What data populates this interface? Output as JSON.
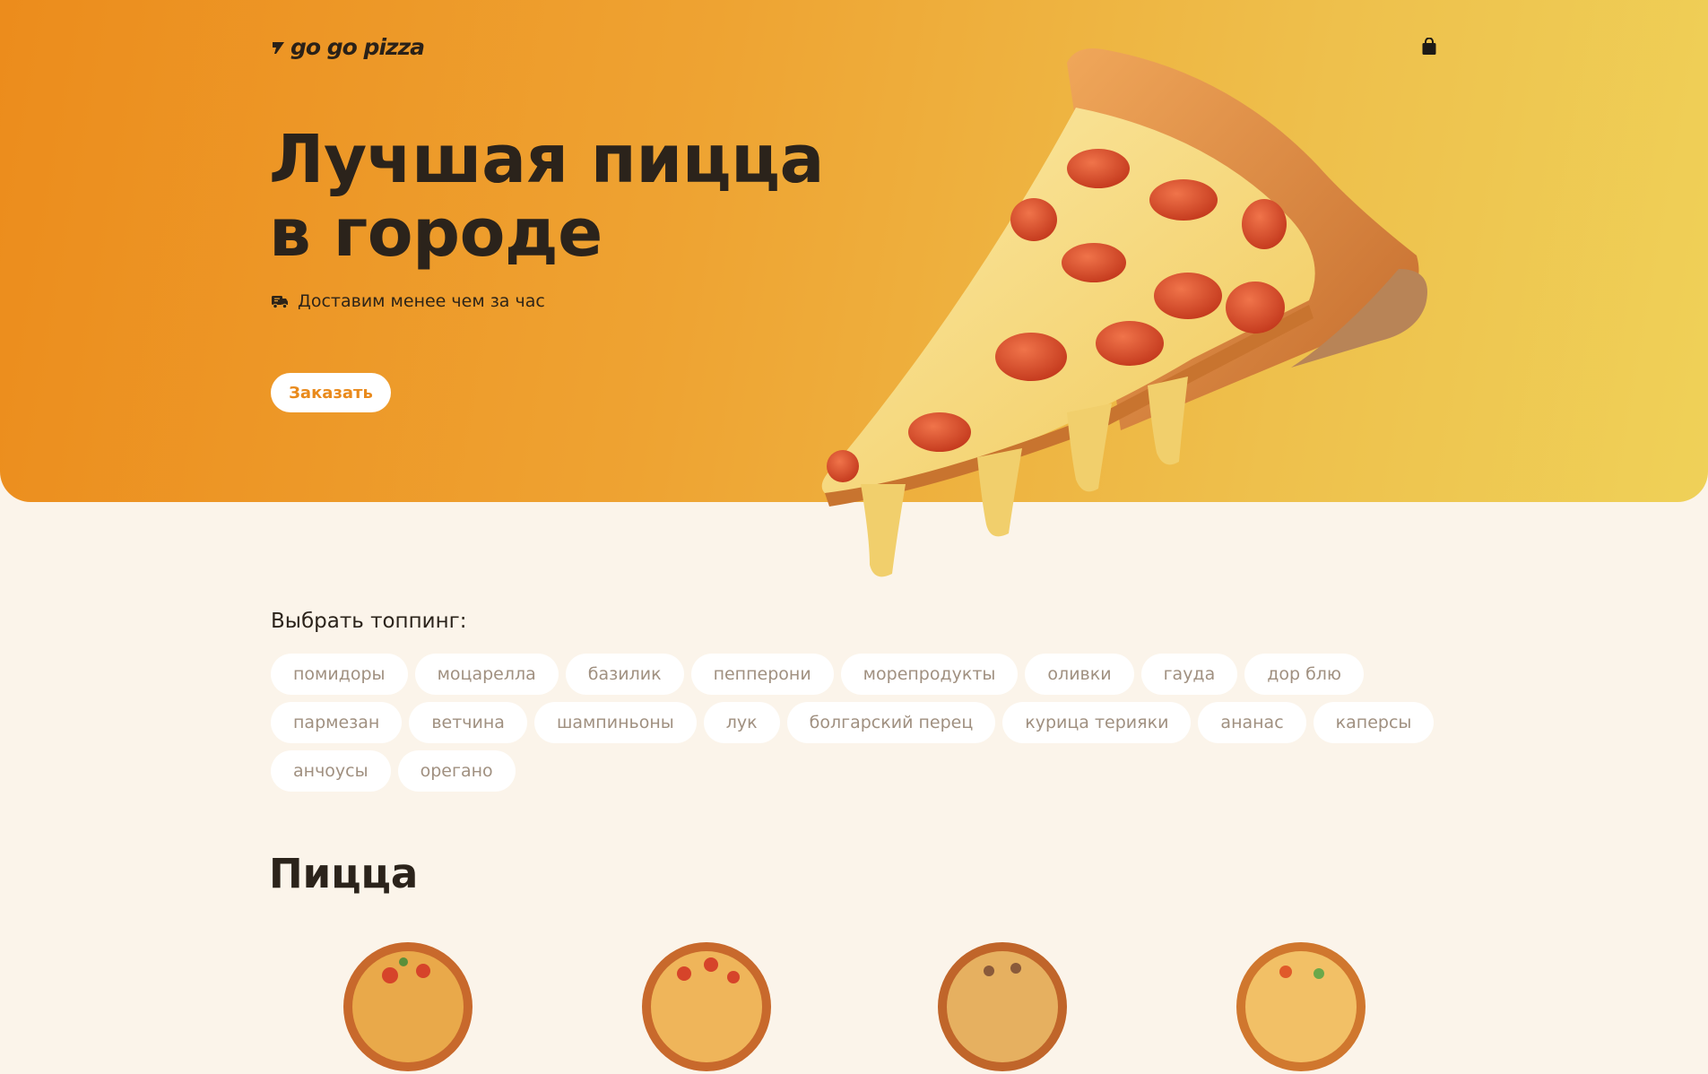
{
  "header": {
    "logo_text": "go go pizza",
    "cart_icon": "shopping-bag-icon"
  },
  "hero": {
    "title_line1": "Лучшая пицца",
    "title_line2": "в городе",
    "delivery_text": "Доставим менее чем за час",
    "delivery_icon": "delivery-truck-icon",
    "order_button": "Заказать",
    "colors": {
      "gradient_start": "#ec8c1c",
      "gradient_end": "#efd158",
      "accent": "#e98a1c"
    }
  },
  "toppings": {
    "title": "Выбрать топпинг:",
    "rows": [
      [
        "помидоры",
        "моцарелла",
        "базилик",
        "пепперони",
        "морепродукты",
        "оливки",
        "гауда",
        "дор блю"
      ],
      [
        "пармезан",
        "ветчина",
        "шампиньоны",
        "лук",
        "болгарский перец",
        "курица терияки",
        "ананас",
        "каперсы"
      ],
      [
        "анчоусы",
        "орегано"
      ]
    ]
  },
  "pizza_section": {
    "title": "Пицца"
  },
  "colors": {
    "page_background": "#fbf4ea",
    "text_dark": "#2b231b",
    "chip_text": "#a09080"
  }
}
